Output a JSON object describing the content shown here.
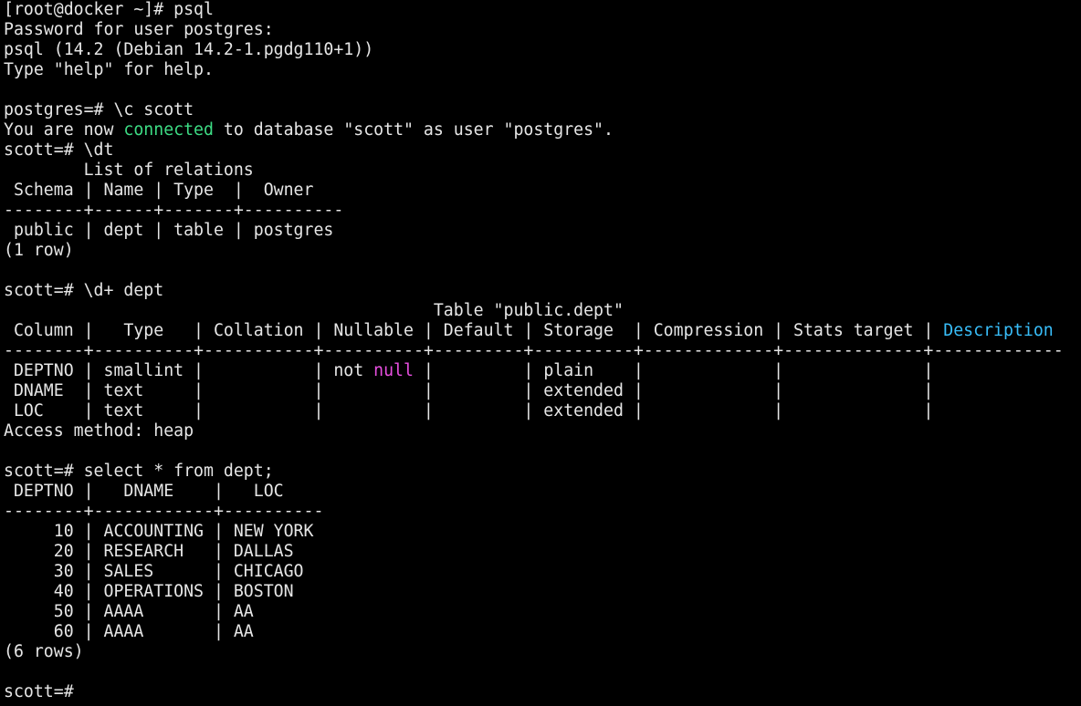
{
  "colors": {
    "background": "#000000",
    "default_text": "#e6e6e6",
    "connected": "#3ddc84",
    "null_keyword": "#e84fe0",
    "description_header": "#38bdf8"
  },
  "terminal": {
    "lines": [
      {
        "segments": [
          {
            "text": "[root@docker ~]# psql"
          }
        ]
      },
      {
        "segments": [
          {
            "text": "Password for user postgres:"
          }
        ]
      },
      {
        "segments": [
          {
            "text": "psql (14.2 (Debian 14.2-1.pgdg110+1))"
          }
        ]
      },
      {
        "segments": [
          {
            "text": "Type \"help\" for help."
          }
        ]
      },
      {
        "segments": [
          {
            "text": ""
          }
        ]
      },
      {
        "segments": [
          {
            "text": "postgres=# \\c scott"
          }
        ]
      },
      {
        "segments": [
          {
            "text": "You are now "
          },
          {
            "text": "connected",
            "color": "#3ddc84"
          },
          {
            "text": " to database \"scott\" as user \"postgres\"."
          }
        ]
      },
      {
        "segments": [
          {
            "text": "scott=# \\dt"
          }
        ]
      },
      {
        "segments": [
          {
            "text": "        List of relations"
          }
        ]
      },
      {
        "segments": [
          {
            "text": " Schema | Name | Type  |  Owner"
          }
        ]
      },
      {
        "segments": [
          {
            "text": "--------+------+-------+----------"
          }
        ]
      },
      {
        "segments": [
          {
            "text": " public | dept | table | postgres"
          }
        ]
      },
      {
        "segments": [
          {
            "text": "(1 row)"
          }
        ]
      },
      {
        "segments": [
          {
            "text": ""
          }
        ]
      },
      {
        "segments": [
          {
            "text": "scott=# \\d+ dept"
          }
        ]
      },
      {
        "segments": [
          {
            "text": "                                           Table \"public.dept\""
          }
        ]
      },
      {
        "segments": [
          {
            "text": " Column |   Type   | Collation | Nullable | Default | Storage  | Compression | Stats target | "
          },
          {
            "text": "Description",
            "color": "#38bdf8"
          }
        ]
      },
      {
        "segments": [
          {
            "text": "--------+----------+-----------+----------+---------+----------+-------------+--------------+-------------"
          }
        ]
      },
      {
        "segments": [
          {
            "text": " DEPTNO | smallint |           | not "
          },
          {
            "text": "null",
            "color": "#e84fe0"
          },
          {
            "text": " |         | plain    |             |              |"
          }
        ]
      },
      {
        "segments": [
          {
            "text": " DNAME  | text     |           |          |         | extended |             |              |"
          }
        ]
      },
      {
        "segments": [
          {
            "text": " LOC    | text     |           |          |         | extended |             |              |"
          }
        ]
      },
      {
        "segments": [
          {
            "text": "Access method: heap"
          }
        ]
      },
      {
        "segments": [
          {
            "text": ""
          }
        ]
      },
      {
        "segments": [
          {
            "text": "scott=# select * from dept;"
          }
        ]
      },
      {
        "segments": [
          {
            "text": " DEPTNO |   DNAME    |   LOC"
          }
        ]
      },
      {
        "segments": [
          {
            "text": "--------+------------+----------"
          }
        ]
      },
      {
        "segments": [
          {
            "text": "     10 | ACCOUNTING | NEW YORK"
          }
        ]
      },
      {
        "segments": [
          {
            "text": "     20 | RESEARCH   | DALLAS"
          }
        ]
      },
      {
        "segments": [
          {
            "text": "     30 | SALES      | CHICAGO"
          }
        ]
      },
      {
        "segments": [
          {
            "text": "     40 | OPERATIONS | BOSTON"
          }
        ]
      },
      {
        "segments": [
          {
            "text": "     50 | AAAA       | AA"
          }
        ]
      },
      {
        "segments": [
          {
            "text": "     60 | AAAA       | AA"
          }
        ]
      },
      {
        "segments": [
          {
            "text": "(6 rows)"
          }
        ]
      },
      {
        "segments": [
          {
            "text": ""
          }
        ]
      },
      {
        "segments": [
          {
            "text": "scott=#"
          }
        ]
      }
    ]
  }
}
